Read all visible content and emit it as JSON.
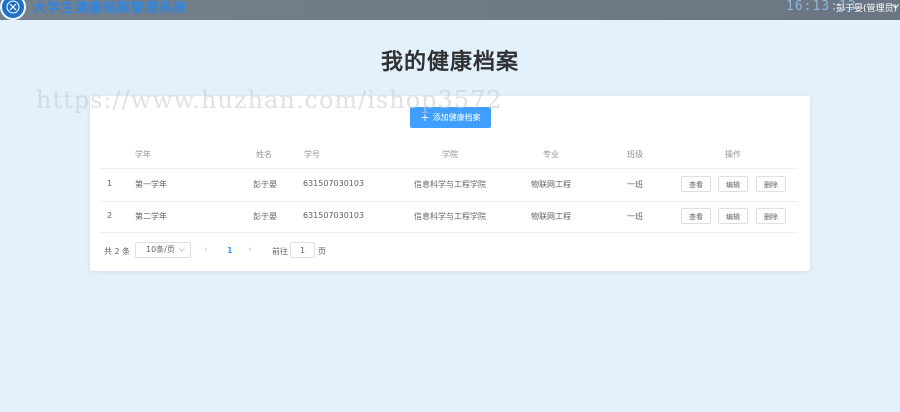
{
  "header": {
    "app_title": "大学生健康档案管理系统",
    "clock": "16:13:13",
    "user_label": "彭于晏(管理员)"
  },
  "page": {
    "title": "我的健康档案",
    "watermark": "https://www.huzhan.com/ishop3572"
  },
  "toolbar": {
    "add_plus": "+",
    "add_label": "添加健康档案"
  },
  "table": {
    "headers": {
      "year": "学年",
      "name": "姓名",
      "student_id": "学号",
      "college": "学院",
      "major": "专业",
      "class": "班级",
      "actions": "操作"
    },
    "actions": {
      "view": "查看",
      "edit": "编辑",
      "delete": "删除"
    },
    "rows": [
      {
        "index": "1",
        "year": "第一学年",
        "name": "彭于晏",
        "student_id": "631507030103",
        "college": "信息科学与工程学院",
        "major": "物联网工程",
        "class": "一班"
      },
      {
        "index": "2",
        "year": "第二学年",
        "name": "彭于晏",
        "student_id": "631507030103",
        "college": "信息科学与工程学院",
        "major": "物联网工程",
        "class": "一班"
      }
    ]
  },
  "pagination": {
    "total_text": "共 2 条",
    "page_size": "10条/页",
    "prev": "‹",
    "current_page": "1",
    "next": "›",
    "goto_label": "前往",
    "goto_value": "1",
    "page_unit": "页"
  },
  "colors": {
    "background": "#e3f1fc",
    "topbar": "#75808c",
    "primary": "#409eff",
    "title_text": "#303133"
  }
}
